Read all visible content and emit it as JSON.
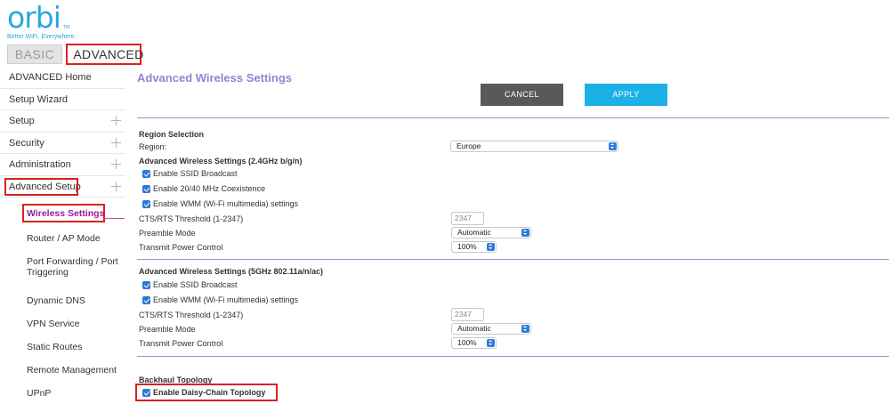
{
  "header": {
    "logo_text": "orbi",
    "logo_tm": "TM",
    "tagline": "Better WiFi. Everywhere.",
    "tabs": {
      "basic": "BASIC",
      "advanced": "ADVANCED"
    }
  },
  "sidebar": {
    "items": [
      {
        "label": "ADVANCED Home",
        "expandable": false
      },
      {
        "label": "Setup Wizard",
        "expandable": false
      },
      {
        "label": "Setup",
        "expandable": true
      },
      {
        "label": "Security",
        "expandable": true
      },
      {
        "label": "Administration",
        "expandable": true
      },
      {
        "label": "Advanced Setup",
        "expandable": true
      }
    ],
    "subitems": [
      "Wireless Settings",
      "Router / AP Mode",
      "Port Forwarding / Port Triggering",
      "Dynamic DNS",
      "VPN Service",
      "Static Routes",
      "Remote Management",
      "UPnP"
    ]
  },
  "main": {
    "title": "Advanced Wireless Settings",
    "cancel_label": "CANCEL",
    "apply_label": "APPLY",
    "region": {
      "section": "Region Selection",
      "label": "Region:",
      "value": "Europe"
    },
    "band24": {
      "section": "Advanced Wireless Settings (2.4GHz b/g/n)",
      "checks": [
        "Enable SSID Broadcast",
        "Enable 20/40 MHz Coexistence",
        "Enable WMM (Wi-Fi multimedia) settings"
      ],
      "cts_label": "CTS/RTS Threshold (1-2347)",
      "cts_value": "2347",
      "preamble_label": "Preamble Mode",
      "preamble_value": "Automatic",
      "power_label": "Transmit Power Control",
      "power_value": "100%"
    },
    "band5": {
      "section": "Advanced Wireless Settings (5GHz 802.11a/n/ac)",
      "checks": [
        "Enable SSID Broadcast",
        "Enable WMM (Wi-Fi multimedia) settings"
      ],
      "cts_label": "CTS/RTS Threshold (1-2347)",
      "cts_value": "2347",
      "preamble_label": "Preamble Mode",
      "preamble_value": "Automatic",
      "power_label": "Transmit Power Control",
      "power_value": "100%"
    },
    "backhaul": {
      "section": "Backhaul Topology",
      "check": "Enable Daisy-Chain Topology"
    }
  },
  "colors": {
    "accent": "#2aa7e0",
    "title": "#9085d8",
    "highlight": "#d9231d",
    "active_sub": "#9b1a99",
    "apply": "#1bb1e6",
    "cancel": "#595959"
  }
}
